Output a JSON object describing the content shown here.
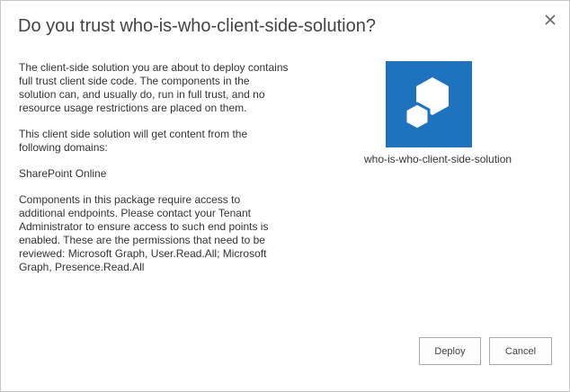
{
  "dialog": {
    "title": "Do you trust who-is-who-client-side-solution?",
    "close_icon": "close-icon"
  },
  "body": {
    "paragraphs": [
      "The client-side solution you are about to deploy contains full trust client side code. The components in the solution can, and usually do, run in full trust, and no resource usage restrictions are placed on them.",
      "This client side solution will get content from the following domains:",
      "SharePoint Online",
      "Components in this package require access to additional endpoints. Please contact your Tenant Administrator to ensure access to such end points is enabled. These are the permissions that need to be reviewed: Microsoft Graph, User.Read.All; Microsoft Graph, Presence.Read.All"
    ]
  },
  "app": {
    "name": "who-is-who-client-side-solution",
    "icon": "app-package-icon",
    "tile_color": "#1e73be"
  },
  "buttons": {
    "deploy_label": "Deploy",
    "cancel_label": "Cancel"
  }
}
